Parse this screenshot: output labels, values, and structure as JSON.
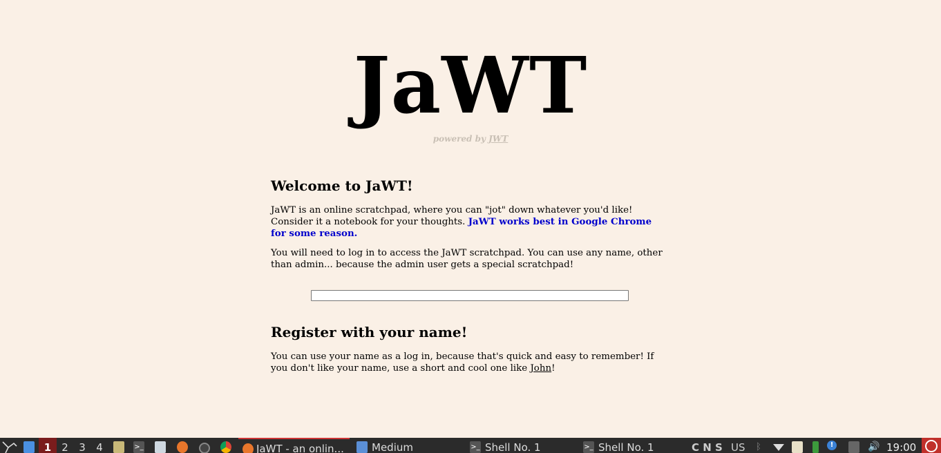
{
  "site": {
    "title": "JaWT",
    "powered_prefix": "powered by ",
    "powered_link": "JWT"
  },
  "welcome": {
    "heading": "Welcome to JaWT!",
    "intro": " JaWT is an online scratchpad, where you can \"jot\" down whatever you'd like! Consider it a notebook for your thoughts. ",
    "intro_highlight": "JaWT works best in Google Chrome for some reason.",
    "login_note": " You will need to log in to access the JaWT scratchpad. You can use any name, other than admin... because the admin user gets a special scratchpad!"
  },
  "login": {
    "value": "",
    "placeholder": ""
  },
  "register": {
    "heading": "Register with your name!",
    "text_before": " You can use your name as a log in, because that's quick and easy to remember! If you don't like your name, use a short and cool one like ",
    "example_link": "John",
    "text_after": "!"
  },
  "taskbar": {
    "workspaces": [
      "1",
      "2",
      "3",
      "4"
    ],
    "active_workspace": "1",
    "tasks": [
      {
        "label": "JaWT - an onlin...",
        "icon": "firefox-icon",
        "active": true
      },
      {
        "label": "Medium",
        "icon": "folder-icon",
        "active": false
      },
      {
        "label": "Shell No. 1",
        "icon": "terminal-icon",
        "active": false
      },
      {
        "label": "Shell No. 1",
        "icon": "terminal-icon",
        "active": false
      }
    ],
    "indicators": "C N S",
    "keyboard_layout": "US",
    "clock": "19:00",
    "accent": "#7a1c1c",
    "background": "#2b2b2b"
  }
}
